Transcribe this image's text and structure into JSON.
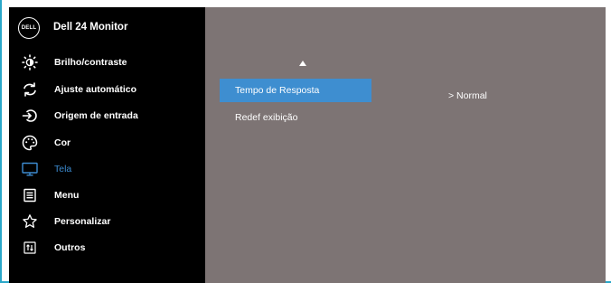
{
  "header": {
    "logo_text": "DELL",
    "title": "Dell 24 Monitor"
  },
  "sidebar": {
    "items": [
      {
        "label": "Brilho/contraste",
        "icon": "brightness-icon"
      },
      {
        "label": "Ajuste automático",
        "icon": "auto-adjust-icon"
      },
      {
        "label": "Origem de entrada",
        "icon": "input-source-icon"
      },
      {
        "label": "Cor",
        "icon": "color-palette-icon"
      },
      {
        "label": "Tela",
        "icon": "display-icon",
        "active": true
      },
      {
        "label": "Menu",
        "icon": "menu-icon"
      },
      {
        "label": "Personalizar",
        "icon": "star-icon"
      },
      {
        "label": "Outros",
        "icon": "others-icon"
      }
    ]
  },
  "main": {
    "scroll_up_icon": "arrow-up-icon",
    "items": [
      {
        "label": "Tempo de Resposta",
        "value": "> Normal",
        "selected": true
      },
      {
        "label": "Redef exibição"
      }
    ]
  },
  "colors": {
    "sidebar_bg": "#000000",
    "main_bg": "#7d7474",
    "highlight": "#3e8ed0",
    "active_text": "#3c8bd0",
    "frame_border": "#2aa7c9"
  }
}
